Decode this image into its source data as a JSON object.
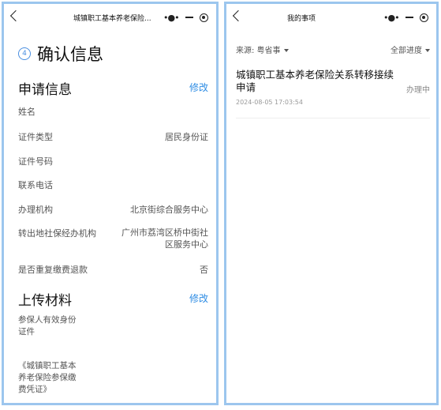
{
  "left": {
    "title": "城镇职工基本养老保险...",
    "step_number": "4",
    "step_title": "确认信息",
    "apply_section": {
      "title": "申请信息",
      "edit_label": "修改"
    },
    "fields": [
      {
        "label": "姓名",
        "value": ""
      },
      {
        "label": "证件类型",
        "value": "居民身份证"
      },
      {
        "label": "证件号码",
        "value": ""
      },
      {
        "label": "联系电话",
        "value": ""
      },
      {
        "label": "办理机构",
        "value": "北京街综合服务中心"
      },
      {
        "label": "转出地社保经办机构",
        "value": "广州市荔湾区桥中街社区服务中心"
      },
      {
        "label": "是否重复缴费退款",
        "value": "否"
      }
    ],
    "upload_section": {
      "title": "上传材料",
      "edit_label": "修改"
    },
    "materials": [
      "参保人有效身份证件",
      "《城镇职工基本养老保险参保缴费凭证》"
    ]
  },
  "right": {
    "title": "我的事项",
    "filter_source": "来源: 粤省事",
    "filter_progress": "全部进度",
    "items": [
      {
        "title": "城镇职工基本养老保险关系转移接续申请",
        "time": "2024-08-05 17:03:54",
        "status": "办理中"
      }
    ]
  },
  "icons": [
    "back-icon",
    "more-icon",
    "minus-icon",
    "target-icon",
    "caret-icon"
  ],
  "colors": {
    "accent": "#2f8de4",
    "panel_border": "#9cc6ee"
  }
}
